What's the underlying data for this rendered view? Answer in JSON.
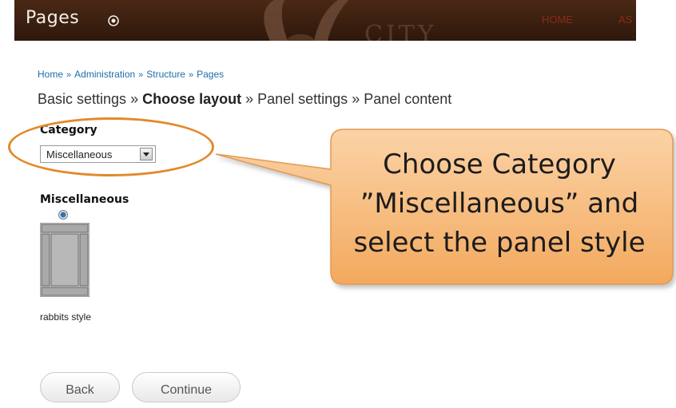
{
  "header": {
    "title": "Pages",
    "nav": [
      "HOME",
      "AS"
    ],
    "watermark": "CITY"
  },
  "breadcrumb": [
    "Home",
    "Administration",
    "Structure",
    "Pages"
  ],
  "breadcrumb_separator": "»",
  "wizard": {
    "steps": [
      "Basic settings",
      "Choose layout",
      "Panel settings",
      "Panel content"
    ],
    "current_step": "Choose layout",
    "separator": "»"
  },
  "category": {
    "label": "Category",
    "selected": "Miscellaneous"
  },
  "layout_group": {
    "label": "Miscellaneous",
    "option_label": "rabbits style"
  },
  "callout": {
    "lines": [
      "Choose Category",
      "”Miscellaneous” and",
      "select the panel style"
    ]
  },
  "buttons": {
    "back": "Back",
    "continue": "Continue"
  },
  "colors": {
    "header_bg": "#3a1f12",
    "link": "#1a6fa8",
    "callout_fill": "#f7b774",
    "highlight": "#e3892a"
  }
}
